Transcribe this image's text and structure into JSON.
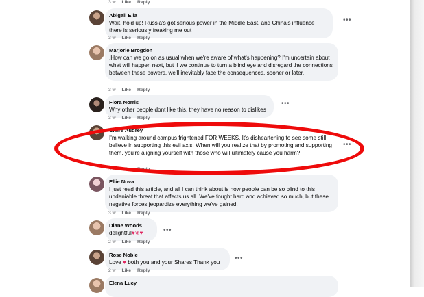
{
  "comments": [
    {
      "name": "",
      "text": "",
      "time": "3 w",
      "like": "Like",
      "reply": "Reply"
    },
    {
      "name": "Abigail Ella",
      "text": "Wait, hold up! Russia's got serious power in the Middle East, and China's influence there is seriously freaking me out",
      "time": "3 w",
      "like": "Like",
      "reply": "Reply"
    },
    {
      "name": "Marjorie Brogdon",
      "text": ",How can we go on as usual when we're aware of what's happening? I'm uncertain about what will happen next, but if we continue to turn a blind eye and disregard the connections between these powers, we'll inevitably face the consequences, sooner or later.",
      "time": "3 w",
      "like": "Like",
      "reply": "Reply"
    },
    {
      "name": "Flora Norris",
      "text": "Why other people dont like this, they have no reason to dislikes",
      "time": "3 w",
      "like": "Like",
      "reply": "Reply"
    },
    {
      "name": "Claire Audrey",
      "text": "I'm walking around campus frightened FOR WEEKS. It's disheartening to see some still believe in supporting this evil axis. When will you realize that by promoting and supporting them, you're aligning yourself with those who will ultimately cause you harm?",
      "time": "3 w",
      "like": "Like",
      "reply": "Reply"
    },
    {
      "name": "Ellie Nova",
      "text": "I just read this article, and all I can think about is how people can be so blind to this undeniable threat that affects us all. We've fought hard and achieved so much, but these negative forces jeopardize everything we've gained.",
      "time": "3 w",
      "like": "Like",
      "reply": "Reply"
    },
    {
      "name": "Diane Woods",
      "text": "delightful",
      "time": "2 w",
      "like": "Like",
      "reply": "Reply"
    },
    {
      "name": "Rose Noble",
      "text_before": "Love",
      "text_after": "both you and your Shares Thank you",
      "time": "2 w",
      "like": "Like",
      "reply": "Reply"
    },
    {
      "name": "Elena Lucy",
      "text": ""
    }
  ],
  "icons": {
    "more": "more-options-icon",
    "emoji_heart": "red-heart-icon"
  },
  "colors": {
    "highlight_circle": "#ee0b0b",
    "bubble_bg": "#f0f2f5",
    "meta_text": "#65676b"
  }
}
